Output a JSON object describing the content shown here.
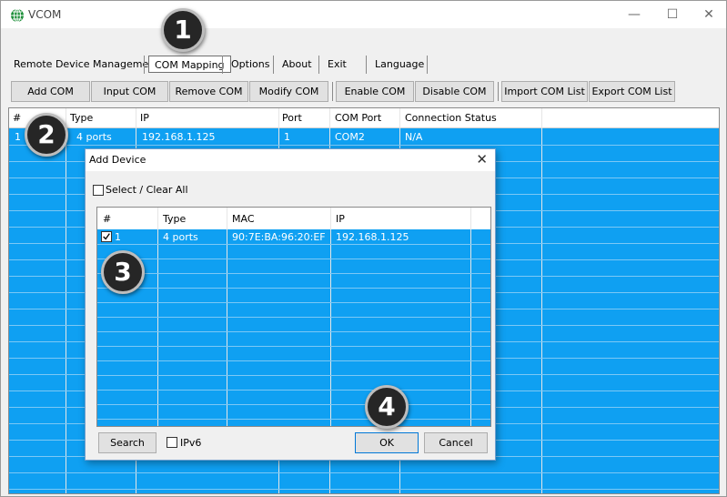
{
  "window": {
    "title": "VCOM",
    "minimize": "—",
    "maximize": "☐",
    "close": "✕"
  },
  "menu": {
    "items": [
      "Remote Device Management",
      "COM Mapping",
      "Options",
      "About",
      "Exit",
      "Language"
    ],
    "active_index": 1
  },
  "toolbar": {
    "buttons": [
      "Add COM",
      "Input COM",
      "Remove COM",
      "Modify COM",
      "Enable COM",
      "Disable COM",
      "Import COM List",
      "Export COM List"
    ]
  },
  "main_table": {
    "columns": [
      "#",
      "Type",
      "IP",
      "Port",
      "COM Port",
      "Connection Status"
    ],
    "rows": [
      {
        "num": "1",
        "type": "4 ports",
        "ip": "192.168.1.125",
        "port": "1",
        "com_port": "COM2",
        "status": "N/A"
      }
    ]
  },
  "dialog": {
    "title": "Add Device",
    "close": "✕",
    "select_all_label": "Select / Clear All",
    "columns": [
      "#",
      "Type",
      "MAC",
      "IP"
    ],
    "rows": [
      {
        "num": "1",
        "type": "4 ports",
        "mac": "90:7E:BA:96:20:EF",
        "ip": "192.168.1.125",
        "checked": true
      }
    ],
    "search_label": "Search",
    "ipv6_label": "IPv6",
    "ok_label": "OK",
    "cancel_label": "Cancel"
  },
  "callouts": [
    "1",
    "2",
    "3",
    "4"
  ],
  "colors": {
    "table_blue": "#0fa0f2",
    "badge": "#262626"
  }
}
